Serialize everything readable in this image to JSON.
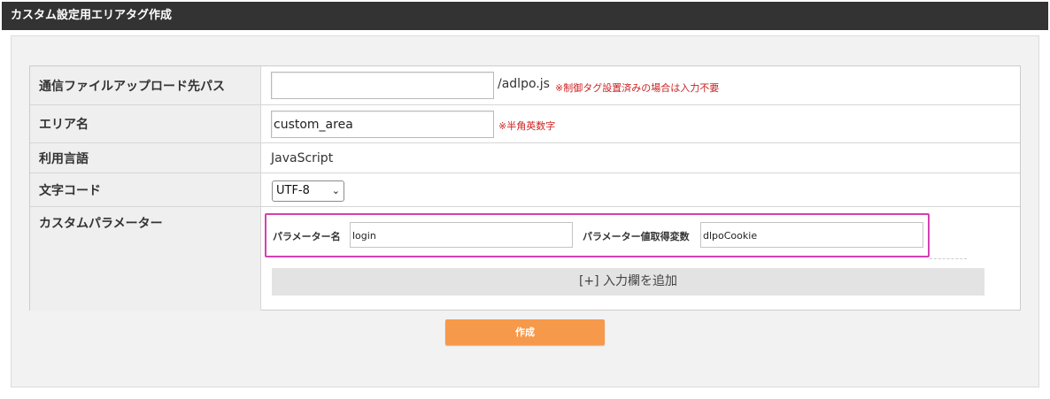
{
  "header": {
    "title": "カスタム設定用エリアタグ作成"
  },
  "form": {
    "upload_path": {
      "label": "通信ファイルアップロード先パス",
      "value": "",
      "suffix": "/adlpo.js",
      "note": "※制御タグ設置済みの場合は入力不要"
    },
    "area_name": {
      "label": "エリア名",
      "value": "custom_area",
      "note": "※半角英数字"
    },
    "language": {
      "label": "利用言語",
      "value": "JavaScript"
    },
    "charset": {
      "label": "文字コード",
      "selected": "UTF-8",
      "chevron_icon": "chevron-down-icon"
    },
    "custom_params": {
      "label": "カスタムパラメーター",
      "param_name_label": "パラメーター名",
      "param_name_value": "login",
      "param_var_label": "パラメーター値取得変数",
      "param_var_value": "dlpoCookie",
      "add_button_label": "[+] 入力欄を追加"
    }
  },
  "actions": {
    "create_label": "作成"
  },
  "colors": {
    "header_bg": "#333333",
    "note_red": "#cc2222",
    "highlight_border": "#d63fb3",
    "create_button": "#f7994a"
  }
}
